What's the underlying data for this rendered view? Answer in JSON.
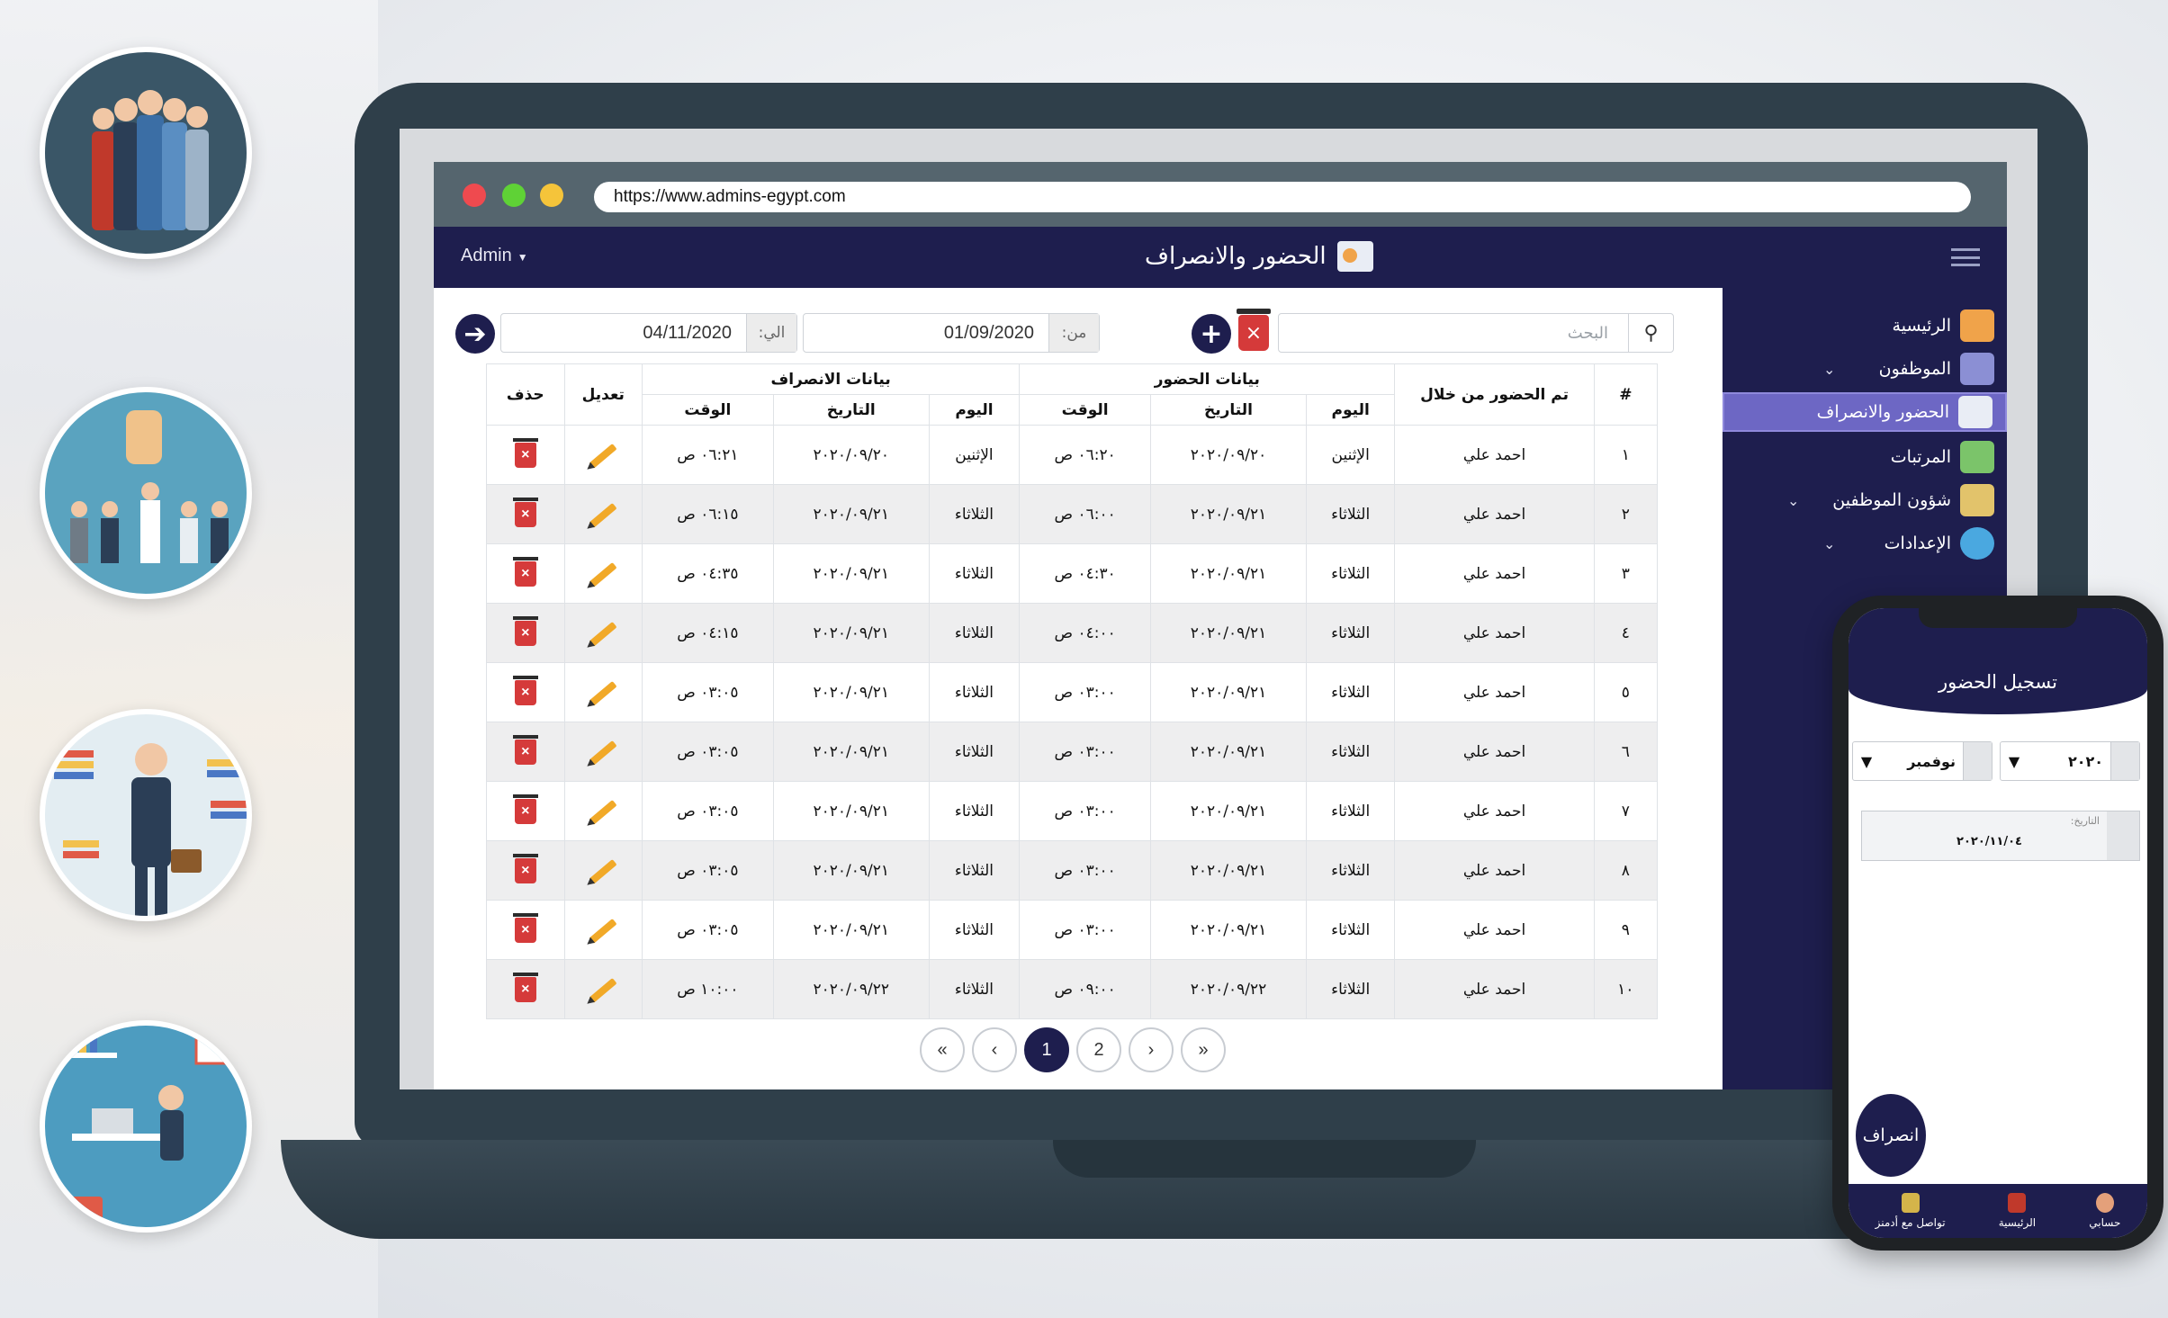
{
  "browser": {
    "url": "https://www.admins-egypt.com"
  },
  "header": {
    "admin_label": "Admin",
    "page_title": "الحضور والانصراف"
  },
  "sidebar": {
    "items": [
      {
        "label": "الرئيسية",
        "icon": "house-icon",
        "color": "#f0a34a"
      },
      {
        "label": "الموظفون",
        "icon": "employees-icon",
        "color": "#8b8fd4"
      },
      {
        "label": "الحضور والانصراف",
        "icon": "attendance-icon",
        "color": "#e9edf5"
      },
      {
        "label": "المرتبات",
        "icon": "money-icon",
        "color": "#7bc46a"
      },
      {
        "label": "شؤون الموظفين",
        "icon": "hr-affairs-icon",
        "color": "#e2c36b"
      },
      {
        "label": "الإعدادات",
        "icon": "gear-icon",
        "color": "#4aa8e0"
      }
    ]
  },
  "toolbar": {
    "search_placeholder": "البحث",
    "from_label": "من:",
    "from_value": "01/09/2020",
    "to_label": "الي:",
    "to_value": "04/11/2020"
  },
  "table": {
    "group_attendance": "بيانات الحضور",
    "group_leave": "بيانات الانصراف",
    "col_num": "#",
    "col_by": "تم الحضور من خلال",
    "col_edit": "تعديل",
    "col_delete": "حذف",
    "sub": {
      "day": "اليوم",
      "date": "التاريخ",
      "time": "الوقت"
    },
    "rows": [
      {
        "num": "١",
        "by": "احمد علي",
        "in_day": "الإثنين",
        "in_date": "٢٠٢٠/٠٩/٢٠",
        "in_time": "٠٦:٢٠ ص",
        "out_day": "الإثنين",
        "out_date": "٢٠٢٠/٠٩/٢٠",
        "out_time": "٠٦:٢١ ص"
      },
      {
        "num": "٢",
        "by": "احمد علي",
        "in_day": "الثلاثاء",
        "in_date": "٢٠٢٠/٠٩/٢١",
        "in_time": "٠٦:٠٠ ص",
        "out_day": "الثلاثاء",
        "out_date": "٢٠٢٠/٠٩/٢١",
        "out_time": "٠٦:١٥ ص"
      },
      {
        "num": "٣",
        "by": "احمد علي",
        "in_day": "الثلاثاء",
        "in_date": "٢٠٢٠/٠٩/٢١",
        "in_time": "٠٤:٣٠ ص",
        "out_day": "الثلاثاء",
        "out_date": "٢٠٢٠/٠٩/٢١",
        "out_time": "٠٤:٣٥ ص"
      },
      {
        "num": "٤",
        "by": "احمد علي",
        "in_day": "الثلاثاء",
        "in_date": "٢٠٢٠/٠٩/٢١",
        "in_time": "٠٤:٠٠ ص",
        "out_day": "الثلاثاء",
        "out_date": "٢٠٢٠/٠٩/٢١",
        "out_time": "٠٤:١٥ ص"
      },
      {
        "num": "٥",
        "by": "احمد علي",
        "in_day": "الثلاثاء",
        "in_date": "٢٠٢٠/٠٩/٢١",
        "in_time": "٠٣:٠٠ ص",
        "out_day": "الثلاثاء",
        "out_date": "٢٠٢٠/٠٩/٢١",
        "out_time": "٠٣:٠٥ ص"
      },
      {
        "num": "٦",
        "by": "احمد علي",
        "in_day": "الثلاثاء",
        "in_date": "٢٠٢٠/٠٩/٢١",
        "in_time": "٠٣:٠٠ ص",
        "out_day": "الثلاثاء",
        "out_date": "٢٠٢٠/٠٩/٢١",
        "out_time": "٠٣:٠٥ ص"
      },
      {
        "num": "٧",
        "by": "احمد علي",
        "in_day": "الثلاثاء",
        "in_date": "٢٠٢٠/٠٩/٢١",
        "in_time": "٠٣:٠٠ ص",
        "out_day": "الثلاثاء",
        "out_date": "٢٠٢٠/٠٩/٢١",
        "out_time": "٠٣:٠٥ ص"
      },
      {
        "num": "٨",
        "by": "احمد علي",
        "in_day": "الثلاثاء",
        "in_date": "٢٠٢٠/٠٩/٢١",
        "in_time": "٠٣:٠٠ ص",
        "out_day": "الثلاثاء",
        "out_date": "٢٠٢٠/٠٩/٢١",
        "out_time": "٠٣:٠٥ ص"
      },
      {
        "num": "٩",
        "by": "احمد علي",
        "in_day": "الثلاثاء",
        "in_date": "٢٠٢٠/٠٩/٢١",
        "in_time": "٠٣:٠٠ ص",
        "out_day": "الثلاثاء",
        "out_date": "٢٠٢٠/٠٩/٢١",
        "out_time": "٠٣:٠٥ ص"
      },
      {
        "num": "١٠",
        "by": "احمد علي",
        "in_day": "الثلاثاء",
        "in_date": "٢٠٢٠/٠٩/٢٢",
        "in_time": "٠٩:٠٠ ص",
        "out_day": "الثلاثاء",
        "out_date": "٢٠٢٠/٠٩/٢٢",
        "out_time": "١٠:٠٠ ص"
      }
    ]
  },
  "pagination": {
    "first": "«",
    "prev": "‹",
    "pages": [
      "1",
      "2"
    ],
    "current_page": "1",
    "next": "›",
    "last": "»"
  },
  "phone": {
    "title": "تسجيل الحضور",
    "year_value": "٢٠٢٠",
    "month_value": "نوفمبر",
    "date_label": "التاريخ:",
    "date_value": "٢٠٢٠/١١/٠٤",
    "leave_button": "انصراف",
    "nav": [
      {
        "label": "حسابي",
        "icon": "user-icon",
        "color": "#e4a07a"
      },
      {
        "label": "الرئيسية",
        "icon": "calendar-icon",
        "color": "#c0392b"
      },
      {
        "label": "تواصل مع أدمنز",
        "icon": "contact-icon",
        "color": "#d4b44a"
      }
    ]
  },
  "colors": {
    "primary": "#1e1e4e",
    "active_sidebar": "#6d67c4",
    "delete": "#d53a3a",
    "edit": "#f1a928"
  }
}
